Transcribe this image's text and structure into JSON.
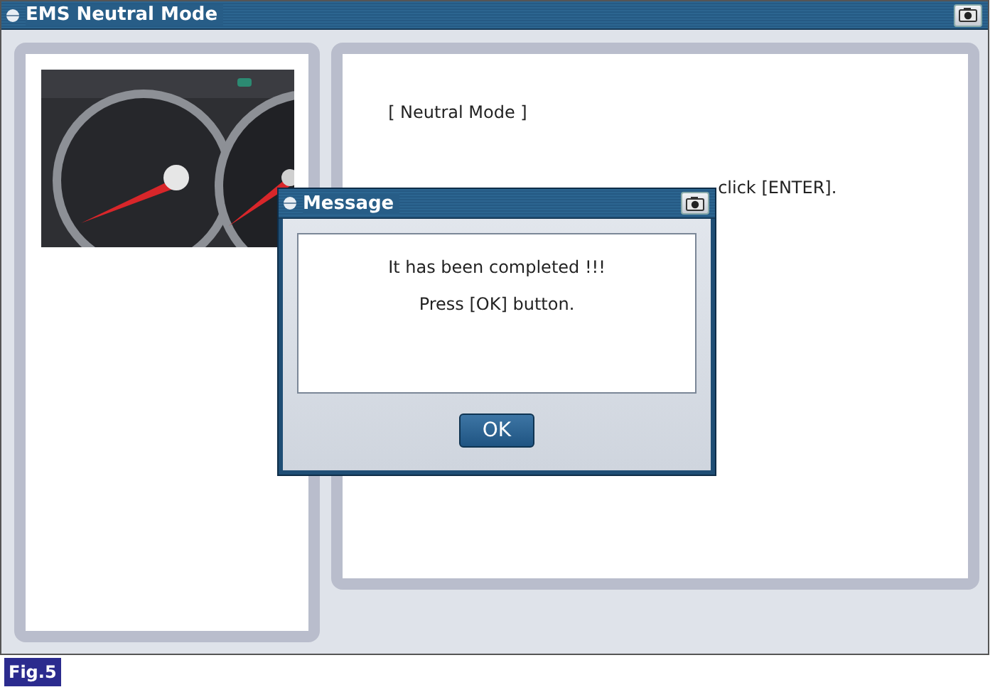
{
  "window": {
    "title": "EMS Neutral Mode"
  },
  "right_panel": {
    "heading": "[ Neutral Mode ]",
    "instruction": "click [ENTER]."
  },
  "dialog": {
    "title": "Message",
    "lines": [
      "It has been completed !!!",
      "Press [OK] button."
    ],
    "buttons": [
      "OK"
    ]
  },
  "caption": "Fig.5"
}
